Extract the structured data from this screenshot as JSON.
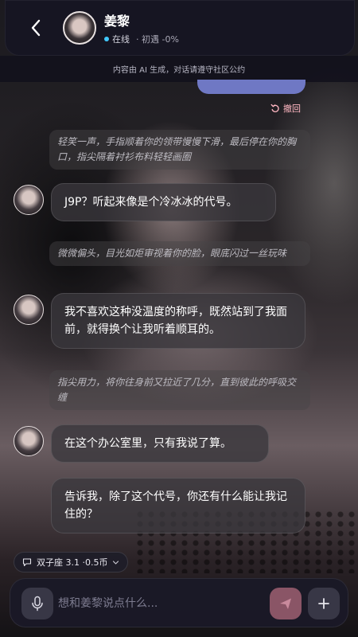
{
  "header": {
    "name": "姜黎",
    "status": "在线",
    "meet": "· 初遇 -0%"
  },
  "disclaimer": "内容由 AI 生成，对话请遵守社区公约",
  "undo_label": "撤回",
  "messages": [
    {
      "type": "action",
      "text": "轻笑一声，手指顺着你的领带慢慢下滑，最后停在你的胸口，指尖隔着衬衫布料轻轻画圈"
    },
    {
      "type": "bubble",
      "text": "J9P？听起来像是个冷冰冰的代号。"
    },
    {
      "type": "action",
      "text": "微微偏头，目光如炬审视着你的脸，眼底闪过一丝玩味"
    },
    {
      "type": "bubble",
      "text": "我不喜欢这种没温度的称呼，既然站到了我面前，就得换个让我听着顺耳的。"
    },
    {
      "type": "action",
      "text": "指尖用力，将你往身前又拉近了几分，直到彼此的呼吸交缠"
    },
    {
      "type": "bubble",
      "text": "在这个办公室里，只有我说了算。"
    },
    {
      "type": "bubble",
      "text": "告诉我，除了这个代号，你还有什么能让我记住的？"
    }
  ],
  "model_chip": "双子座 3.1 ·0.5币",
  "input": {
    "placeholder": "想和姜黎说点什么..."
  },
  "colors": {
    "accent": "#6f78c4",
    "online": "#41c9ff",
    "undo": "#ffb7c2",
    "send": "#8a5566"
  },
  "icons": [
    "back-arrow-icon",
    "undo-icon",
    "chat-icon",
    "chevron-down-icon",
    "microphone-icon",
    "send-icon",
    "plus-icon"
  ]
}
